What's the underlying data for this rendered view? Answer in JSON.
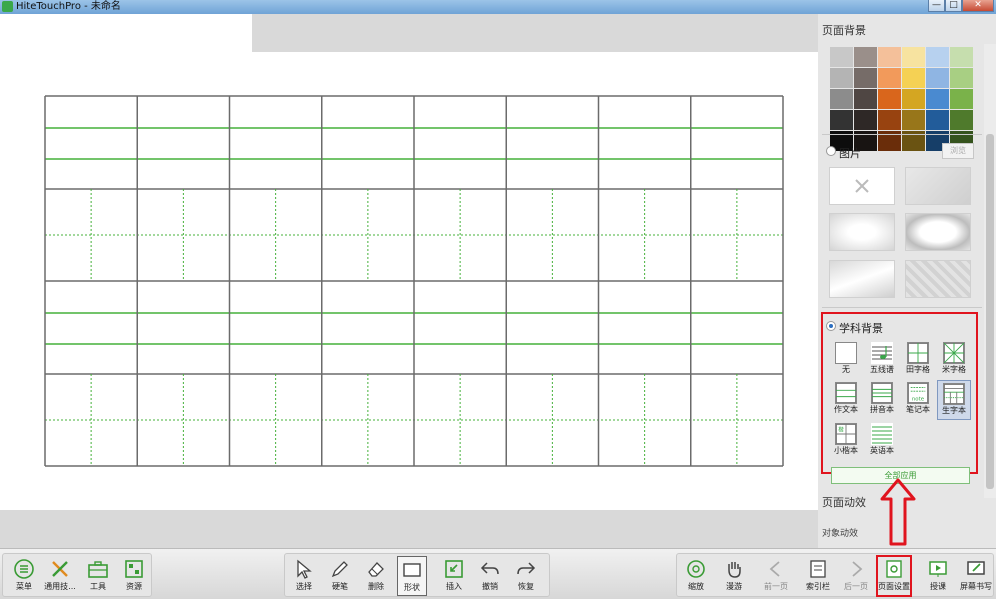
{
  "window": {
    "title": "HiteTouchPro - 未命名",
    "minimize_label": "—",
    "maximize_label": "□",
    "close_label": "✕"
  },
  "panel": {
    "title": "页面背景",
    "palette": [
      "#c8c8c8",
      "#9a8f8a",
      "#f4c09a",
      "#f7e3a0",
      "#b7d1ef",
      "#c6deae",
      "#b4b4b4",
      "#766c68",
      "#f29a5b",
      "#f5d154",
      "#8fb5e3",
      "#a8cf83",
      "#8c8c8c",
      "#4f4643",
      "#d9661c",
      "#d4a622",
      "#4a8ad0",
      "#7ab24a",
      "#333333",
      "#2e2826",
      "#984310",
      "#98761a",
      "#225c9a",
      "#4f7a2c",
      "#0d0d0d",
      "#181412",
      "#6a2d0a",
      "#6a5312",
      "#163e68",
      "#35531d"
    ],
    "image_label": "图片",
    "browse_label": "浏览",
    "subject_label": "学科背景",
    "subjects": [
      {
        "name": "无",
        "icon": "blank-page-icon"
      },
      {
        "name": "五线谱",
        "icon": "music-staff-icon"
      },
      {
        "name": "田字格",
        "icon": "tian-grid-icon"
      },
      {
        "name": "米字格",
        "icon": "mi-grid-icon"
      },
      {
        "name": "作文本",
        "icon": "composition-icon"
      },
      {
        "name": "拼音本",
        "icon": "pinyin-icon"
      },
      {
        "name": "笔记本",
        "icon": "note-icon"
      },
      {
        "name": "生字本",
        "icon": "character-book-icon"
      },
      {
        "name": "小楷本",
        "icon": "xiaokai-icon"
      },
      {
        "name": "英语本",
        "icon": "english-icon"
      }
    ],
    "note_icon_text": "note",
    "xiaokai_icon_text": "楷",
    "apply_all_label": "全部应用",
    "effect_title": "页面动效",
    "effect_sub": "对象动效"
  },
  "toolbar": {
    "left": [
      {
        "label": "菜单",
        "icon": "menu-icon"
      },
      {
        "label": "通用技...",
        "icon": "general-tools-icon"
      },
      {
        "label": "工具",
        "icon": "toolbox-icon"
      },
      {
        "label": "资源",
        "icon": "resources-icon"
      }
    ],
    "center": [
      {
        "label": "选择",
        "icon": "select-cursor-icon"
      },
      {
        "label": "硬笔",
        "icon": "pen-icon"
      },
      {
        "label": "删除",
        "icon": "eraser-icon"
      },
      {
        "label": "形状",
        "icon": "shape-icon"
      },
      {
        "label": "插入",
        "icon": "insert-icon"
      },
      {
        "label": "撤销",
        "icon": "undo-icon"
      },
      {
        "label": "恢复",
        "icon": "redo-icon"
      }
    ],
    "right": [
      {
        "label": "缩放",
        "icon": "zoom-icon"
      },
      {
        "label": "漫游",
        "icon": "pan-hand-icon"
      },
      {
        "label": "前一页",
        "icon": "prev-page-icon"
      },
      {
        "label": "索引栏",
        "icon": "index-icon"
      },
      {
        "label": "后一页",
        "icon": "next-page-icon"
      },
      {
        "label": "页面设置",
        "icon": "page-settings-icon"
      },
      {
        "label": "授课",
        "icon": "teach-icon"
      },
      {
        "label": "屏幕书写",
        "icon": "screen-write-icon"
      }
    ]
  },
  "colors": {
    "grid_border": "#6b6b6b",
    "grid_green": "#45b03a",
    "annotation_red": "#e0141e"
  }
}
